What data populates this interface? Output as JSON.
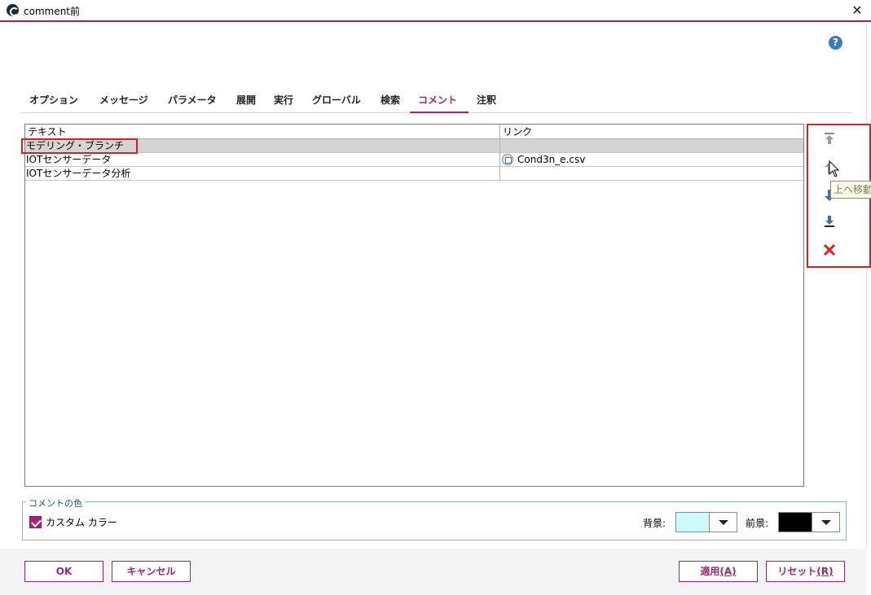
{
  "window": {
    "title": "comment前"
  },
  "tabs": [
    {
      "label": "オプション"
    },
    {
      "label": "メッセージ"
    },
    {
      "label": "パラメータ"
    },
    {
      "label": "展開"
    },
    {
      "label": "実行"
    },
    {
      "label": "グローバル"
    },
    {
      "label": "検索"
    },
    {
      "label": "コメント",
      "active": true
    },
    {
      "label": "注釈"
    }
  ],
  "table": {
    "headers": {
      "text": "テキスト",
      "link": "リンク"
    },
    "rows": [
      {
        "text": "モデリング・ブランチ",
        "link": "",
        "selected": true
      },
      {
        "text": "IOTセンサーデータ",
        "link": "Cond3n_e.csv"
      },
      {
        "text": "IOTセンサーデータ分析",
        "link": ""
      }
    ]
  },
  "side_buttons": {
    "tooltip": "上へ移動",
    "items": [
      "move-top-icon",
      "move-up-icon",
      "move-down-icon",
      "move-bottom-icon",
      "delete-icon"
    ]
  },
  "comment_color": {
    "group_label": "コメントの色",
    "custom_color_label": "カスタム カラー",
    "custom_color_checked": true,
    "background_label": "背景:",
    "foreground_label": "前景:",
    "background_color": "#ccfbff",
    "foreground_color": "#000000"
  },
  "footer": {
    "ok_label": "OK",
    "cancel_label": "キャンセル",
    "apply_label": "適用",
    "apply_mnemonic": "(A)",
    "reset_label": "リセット",
    "reset_mnemonic": "(R)"
  },
  "colors": {
    "accent": "#a3256f",
    "highlight_red": "#d0222a",
    "selected_row": "#d4d4d4"
  }
}
